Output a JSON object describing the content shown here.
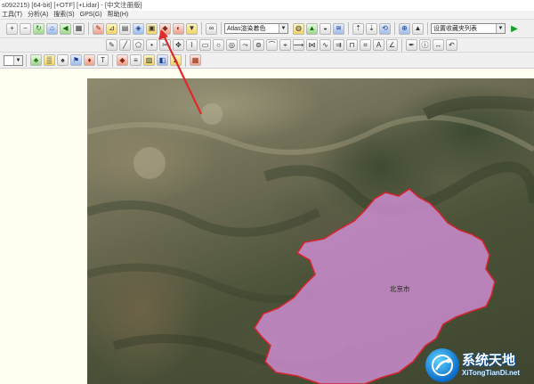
{
  "window": {
    "title": "s092215) [64-bit] [+OTF] [+Lidar] - [中文注册版]"
  },
  "menu": [
    "工具(T)",
    "分析(A)",
    "搜索(S)",
    "GPS(G)",
    "帮助(H)"
  ],
  "toolbar": {
    "shader_select": "Atlas渲染着色",
    "favorites_select": "设置收藏夹列表"
  },
  "map": {
    "region_label": "北京市",
    "boundary_color": "#d0262b",
    "fill_color": "#d18fd6"
  },
  "watermark": {
    "brand_cn": "系统天地",
    "brand_en": "XiTongTianDi.net",
    "accent_color": "#0a6cc9"
  },
  "annotation": {
    "arrow_color": "#e02a2a"
  }
}
